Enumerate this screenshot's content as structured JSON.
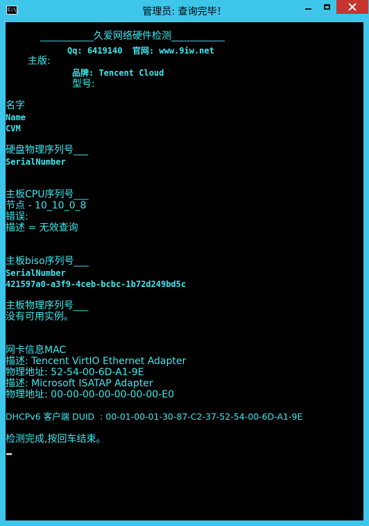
{
  "window": {
    "icon_label": "C:\\_",
    "title": "管理员: 查询完毕！"
  },
  "console": {
    "lines": [
      "___________久爱网络硬件检测___________",
      "Qq: 6419140  官网: www.9iw.net",
      "主版:",
      "品牌: Tencent Cloud",
      "型号:",
      "名字",
      "Name",
      "CVM",
      "硬盘物理序列号___",
      "SerialNumber",
      "主板CPU序列号___",
      "节点 - 10_10_0_8",
      "错误:",
      "描述 = 无效查询",
      "主板biso序列号___",
      "SerialNumber",
      "421597a0-a3f9-4ceb-bcbc-1b72d249bd5c",
      "主板物理序列号___",
      "没有可用实例。",
      "网卡信息MAC",
      "描述: Tencent VirtIO Ethernet Adapter",
      "物理地址: 52-54-00-6D-A1-9E",
      "描述: Microsoft ISATAP Adapter",
      "物理地址: 00-00-00-00-00-00-00-E0",
      "DHCPv6 客户端 DUID  : 00-01-00-01-30-87-C2-37-52-54-00-6D-A1-9E",
      "检测完成,按回车结束。"
    ]
  },
  "colors": {
    "title_bar": "#3ec6ea",
    "close_button": "#c7352f",
    "console_bg": "#000000",
    "console_text": "#3ee8ee"
  },
  "icons": [
    "console-app-icon",
    "minimize-icon",
    "maximize-icon",
    "close-icon"
  ]
}
